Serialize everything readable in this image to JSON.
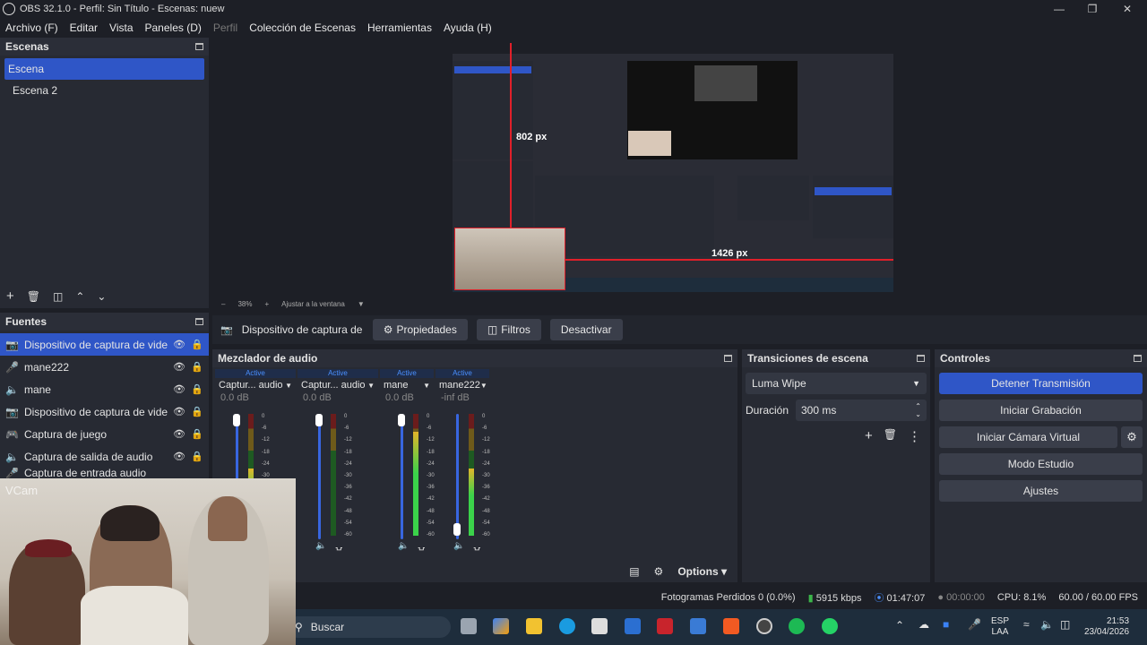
{
  "window": {
    "title": "OBS 32.1.0 - Perfil: Sin Título - Escenas: nuew"
  },
  "menu": [
    "Archivo (F)",
    "Editar",
    "Vista",
    "Paneles (D)",
    "Perfil",
    "Colección de Escenas",
    "Herramientas",
    "Ayuda (H)"
  ],
  "scenes": {
    "title": "Escenas",
    "items": [
      "Escena",
      "Escena 2"
    ]
  },
  "preview": {
    "dim_v": "802 px",
    "dim_h": "1426 px",
    "zoom": "38%",
    "fit": "Ajustar a la ventana"
  },
  "source_bar": {
    "name": "Dispositivo de captura de v",
    "props": "Propiedades",
    "filters": "Filtros",
    "deactivate": "Desactivar"
  },
  "sources": {
    "title": "Fuentes",
    "items": [
      {
        "icon": "camera-icon",
        "name": "Dispositivo de captura de video"
      },
      {
        "icon": "mic-icon",
        "name": "mane222"
      },
      {
        "icon": "speaker-icon",
        "name": "mane"
      },
      {
        "icon": "camera-icon",
        "name": "Dispositivo de captura de video"
      },
      {
        "icon": "gamepad-icon",
        "name": "Captura de juego"
      },
      {
        "icon": "speaker-icon",
        "name": "Captura de salida de audio"
      },
      {
        "icon": "mic-icon",
        "name": "Captura de entrada audio"
      }
    ],
    "webcam_label": "VCam"
  },
  "mixer": {
    "title": "Mezclador de audio",
    "channels": [
      {
        "active": "Active",
        "name": "Captur... audio",
        "db": "0.0 dB",
        "level": 0.55
      },
      {
        "active": "Active",
        "name": "Captur... audio",
        "db": "0.0 dB",
        "level": 0.0
      },
      {
        "active": "Active",
        "name": "mane",
        "db": "0.0 dB",
        "level": 0.85
      },
      {
        "active": "Active",
        "name": "mane222",
        "db": "-inf dB",
        "level": 0.55
      }
    ],
    "scale": [
      "0",
      "-6",
      "-12",
      "-18",
      "-24",
      "-30",
      "-36",
      "-42",
      "-48",
      "-54",
      "-60"
    ],
    "options": "Options"
  },
  "transitions": {
    "title": "Transiciones de escena",
    "type": "Luma Wipe",
    "duration_label": "Duración",
    "duration": "300 ms"
  },
  "controls": {
    "title": "Controles",
    "buttons": [
      "Detener Transmisión",
      "Iniciar Grabación",
      "Iniciar Cámara Virtual",
      "Modo Estudio",
      "Ajustes"
    ]
  },
  "status": {
    "dropped": "Fotogramas Perdidos 0 (0.0%)",
    "kbps": "5915 kbps",
    "stream_time": "01:47:07",
    "rec_time": "00:00:00",
    "cpu": "CPU: 8.1%",
    "fps": "60.00 / 60.00 FPS"
  },
  "taskbar": {
    "search": "Buscar",
    "lang1": "ESP",
    "lang2": "LAA",
    "time": "21:53",
    "date": "23/04/2026"
  }
}
